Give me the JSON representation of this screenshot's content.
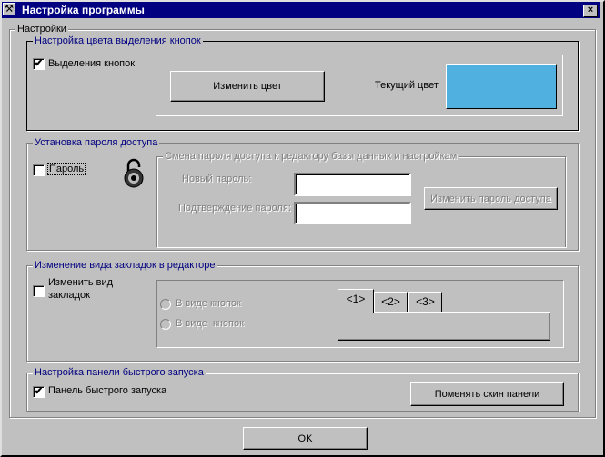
{
  "window": {
    "title": "Настройка программы",
    "close_label": "×"
  },
  "settings_group": {
    "label": "Настройки"
  },
  "highlight": {
    "legend": "Настройка цвета выделения кнопок",
    "checkbox_label": "Выделения кнопок",
    "checked": true,
    "change_color_button": "Изменить цвет",
    "current_color_label": "Текущий цвет",
    "current_color": "#50b0e0"
  },
  "password": {
    "legend": "Установка пароля доступа",
    "checkbox_label": "Пароль",
    "checked": false,
    "inner_legend": "Смена пароля доступа к редактору базы данных и настройкам",
    "new_password_label": "Новый пароль:",
    "new_password_value": "",
    "confirm_label": "Подтверждение пароля:",
    "confirm_value": "",
    "change_button": "Изменить пароль доступа"
  },
  "tabs_view": {
    "legend": "Изменение вида закладок в редакторе",
    "checkbox_label_line1": "Изменить вид",
    "checkbox_label_line2": "закладок",
    "checked": false,
    "radio1": "В виде кнопок",
    "radio2": "В виде  кнопок",
    "tabs": [
      "<1>",
      "<2>",
      "<3>"
    ]
  },
  "quick_panel": {
    "legend": "Настройка панели быстрого запуска",
    "checkbox_label": "Панель быстрого запуска",
    "checked": true,
    "skin_button": "Поменять скин панели"
  },
  "ok_button": "OK"
}
